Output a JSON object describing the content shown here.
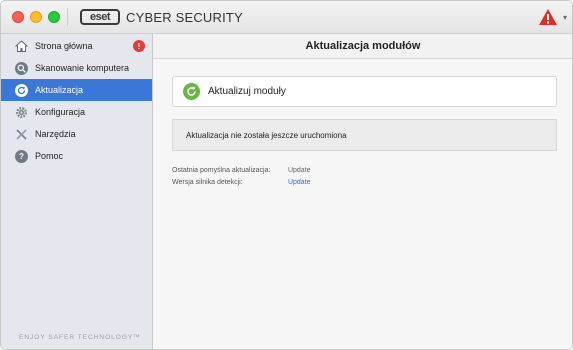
{
  "titlebar": {
    "logo_text": "eset",
    "product_name": "CYBER SECURITY",
    "alert_icon": "warning-triangle-icon"
  },
  "sidebar": {
    "items": [
      {
        "label": "Strona główna",
        "icon": "home-icon",
        "badge": "!"
      },
      {
        "label": "Skanowanie komputera",
        "icon": "search-icon"
      },
      {
        "label": "Aktualizacja",
        "icon": "refresh-icon",
        "active": true
      },
      {
        "label": "Konfiguracja",
        "icon": "gear-icon"
      },
      {
        "label": "Narzędzia",
        "icon": "tools-icon"
      },
      {
        "label": "Pomoc",
        "icon": "help-icon"
      }
    ],
    "tagline": "ENJOY SAFER TECHNOLOGY™"
  },
  "main": {
    "title": "Aktualizacja modułów",
    "update_button": "Aktualizuj moduły",
    "status": "Aktualizacja nie została jeszcze uruchomiona",
    "info": [
      {
        "label": "Ostatnia pomyślna aktualizacja:",
        "value": "Update"
      },
      {
        "label": "Wersja silnika detekcji:",
        "value": "Update"
      }
    ]
  },
  "colors": {
    "accent": "#3a77d6",
    "badge": "#e23b3b",
    "refresh_green": "#6ab545",
    "link": "#2f6fcb"
  }
}
